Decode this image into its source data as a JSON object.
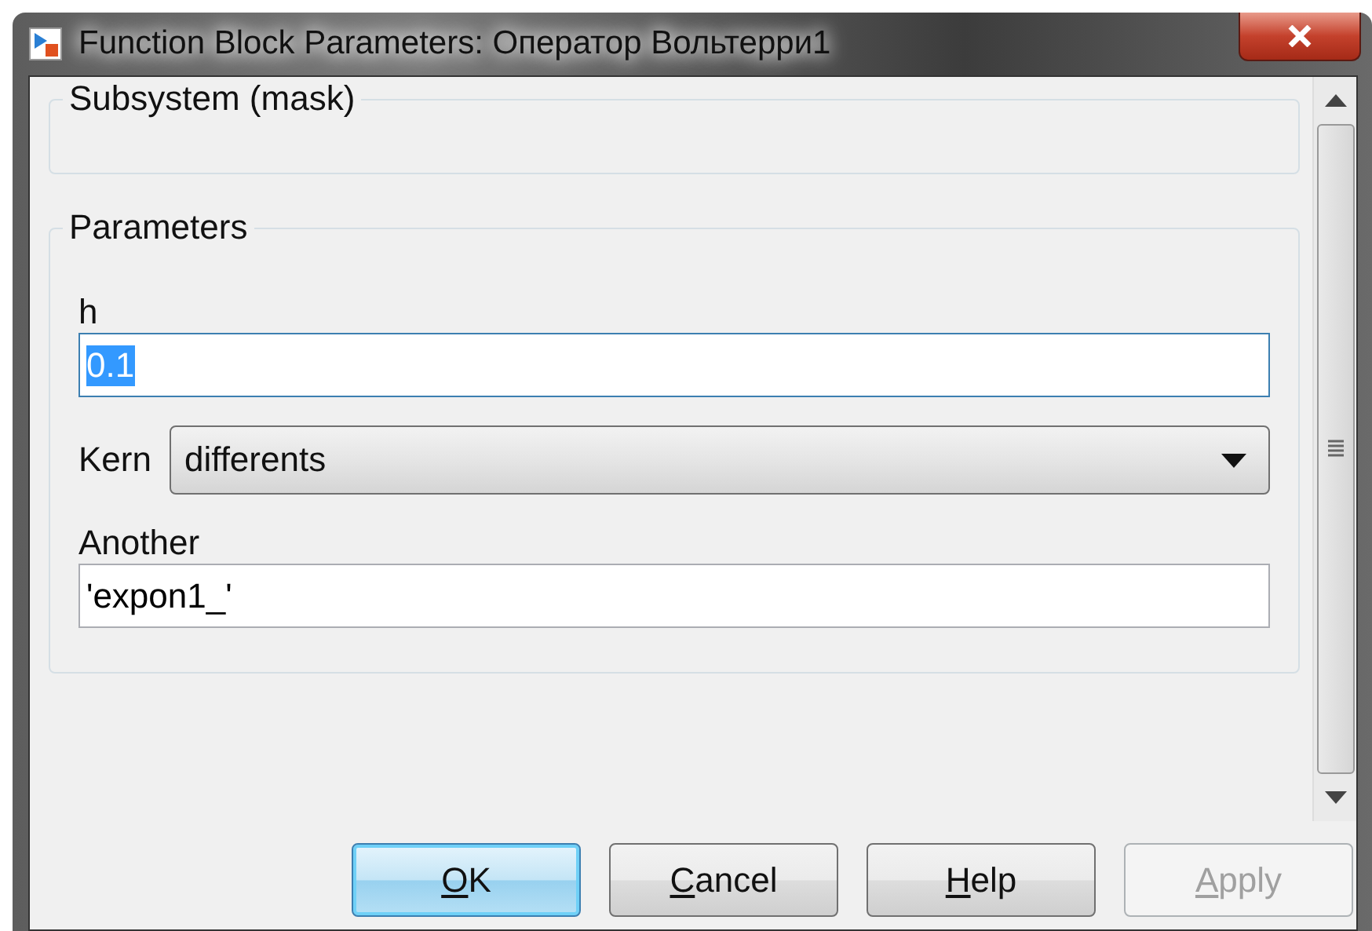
{
  "window": {
    "title": "Function Block Parameters: Оператор Вольтерри1"
  },
  "groups": [
    {
      "title": "Subsystem (mask)",
      "kind": "empty"
    },
    {
      "title": "Parameters",
      "kind": "params",
      "fields": [
        {
          "kind": "text",
          "label": "h",
          "value": "0.1",
          "focused": true,
          "selected_text": true
        },
        {
          "kind": "dropdown",
          "label": "Kern",
          "value": "differents"
        },
        {
          "kind": "text",
          "label": "Another",
          "value": "'expon1_'",
          "focused": false,
          "selected_text": false
        }
      ]
    }
  ],
  "buttons": [
    {
      "label": "OK",
      "default": true,
      "disabled": false
    },
    {
      "label": "Cancel",
      "default": false,
      "disabled": false
    },
    {
      "label": "Help",
      "default": false,
      "disabled": false
    },
    {
      "label": "Apply",
      "default": false,
      "disabled": true
    }
  ]
}
